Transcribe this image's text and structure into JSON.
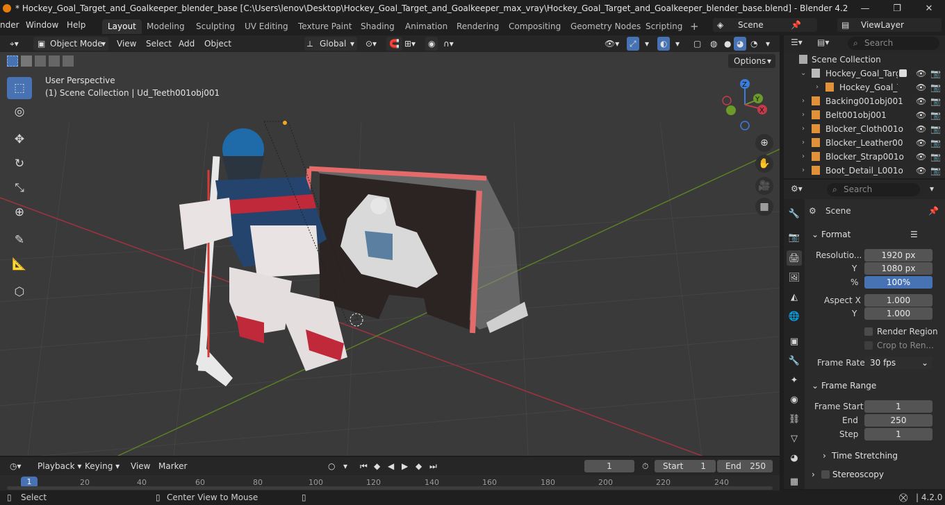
{
  "window": {
    "title": "* Hockey_Goal_Target_and_Goalkeeper_blender_base [C:\\Users\\lenov\\Desktop\\Hockey_Goal_Target_and_Goalkeeper_max_vray\\Hockey_Goal_Target_and_Goalkeeper_blender_base.blend] - Blender 4.2",
    "minimize": "—",
    "maximize": "❐",
    "close": "✕"
  },
  "menu": [
    "nder",
    "Window",
    "Help"
  ],
  "workspaces": [
    "Layout",
    "Modeling",
    "Sculpting",
    "UV Editing",
    "Texture Paint",
    "Shading",
    "Animation",
    "Rendering",
    "Compositing",
    "Geometry Nodes",
    "Scripting"
  ],
  "workspace_add": "+",
  "scene_name": "Scene",
  "view_layer": "ViewLayer",
  "viewport_header": {
    "mode": "Object Mode",
    "view": "View",
    "select": "Select",
    "add": "Add",
    "object": "Object",
    "orientation": "Global"
  },
  "viewport": {
    "perspective": "User Perspective",
    "collection_info": "(1) Scene Collection | Ud_Teeth001obj001",
    "options": "Options",
    "gizmo": {
      "z": "Z",
      "y": "Y",
      "x": "X"
    },
    "colors": {
      "x_axis": "#c33b4a",
      "y_axis": "#6b9a2a",
      "z_axis": "#3b7ddb"
    }
  },
  "outliner": {
    "search_placeholder": "Search",
    "root": "Scene Collection",
    "items": [
      {
        "label": "Hockey_Goal_Targe",
        "indent": 1
      },
      {
        "label": "Hockey_Goal_T",
        "indent": 2
      },
      {
        "label": "Backing001obj001",
        "indent": 1
      },
      {
        "label": "Belt001obj001",
        "indent": 1
      },
      {
        "label": "Blocker_Cloth001o",
        "indent": 1
      },
      {
        "label": "Blocker_Leather00",
        "indent": 1
      },
      {
        "label": "Blocker_Strap001o",
        "indent": 1
      },
      {
        "label": "Boot_Detail_L001o",
        "indent": 1
      }
    ]
  },
  "properties": {
    "search_placeholder": "Search",
    "context": "Scene",
    "format_panel": "Format",
    "resolution_label": "Resolutio...",
    "resolution_x": "1920 px",
    "y_label": "Y",
    "resolution_y": "1080 px",
    "percent_label": "%",
    "resolution_percent": "100%",
    "aspect_x_label": "Aspect X",
    "aspect_x": "1.000",
    "aspect_y": "1.000",
    "render_region": "Render Region",
    "crop": "Crop to Ren...",
    "frame_rate_label": "Frame Rate",
    "frame_rate": "30 fps",
    "frame_range_panel": "Frame Range",
    "frame_start_label": "Frame Start",
    "frame_start": "1",
    "end_label": "End",
    "frame_end": "250",
    "step_label": "Step",
    "frame_step": "1",
    "time_stretching": "Time Stretching",
    "stereoscopy": "Stereoscopy"
  },
  "timeline": {
    "playback": "Playback",
    "keying": "Keying",
    "view": "View",
    "marker": "Marker",
    "current_frame": "1",
    "start_label": "Start",
    "start": "1",
    "end_label": "End",
    "end": "250",
    "ruler": [
      "1",
      "20",
      "40",
      "60",
      "80",
      "100",
      "120",
      "140",
      "160",
      "180",
      "200",
      "220",
      "240"
    ]
  },
  "status": {
    "select": "Select",
    "center_view": "Center View to Mouse",
    "version": "4.2.0"
  }
}
